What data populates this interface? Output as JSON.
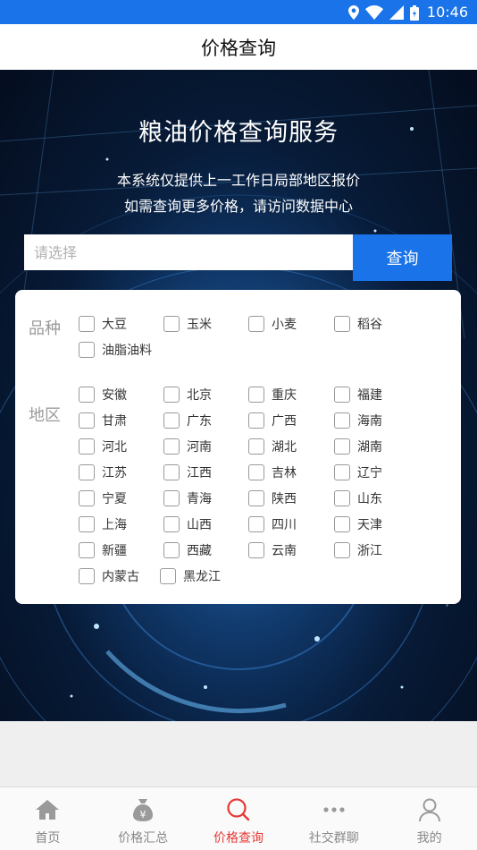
{
  "status_bar": {
    "time": "10:46",
    "bg_color": "#1a73e8"
  },
  "header": {
    "title": "价格查询"
  },
  "hero": {
    "title": "粮油价格查询服务",
    "subtitle_line1": "本系统仅提供上一工作日局部地区报价",
    "subtitle_line2": "如需查询更多价格，请访问数据中心"
  },
  "search": {
    "placeholder": "请选择",
    "value": "",
    "button_label": "查询",
    "accent_color": "#1a73e8"
  },
  "filters": {
    "variety": {
      "label": "品种",
      "options": [
        "大豆",
        "玉米",
        "小麦",
        "稻谷",
        "油脂油料"
      ]
    },
    "region": {
      "label": "地区",
      "options": [
        "安徽",
        "北京",
        "重庆",
        "福建",
        "甘肃",
        "广东",
        "广西",
        "海南",
        "河北",
        "河南",
        "湖北",
        "湖南",
        "江苏",
        "江西",
        "吉林",
        "辽宁",
        "宁夏",
        "青海",
        "陕西",
        "山东",
        "上海",
        "山西",
        "四川",
        "天津",
        "新疆",
        "西藏",
        "云南",
        "浙江",
        "内蒙古",
        "黑龙江"
      ]
    }
  },
  "tab_bar": {
    "active_color": "#e53935",
    "items": [
      {
        "label": "首页",
        "icon": "home-icon"
      },
      {
        "label": "价格汇总",
        "icon": "money-bag-icon"
      },
      {
        "label": "价格查询",
        "icon": "search-icon"
      },
      {
        "label": "社交群聊",
        "icon": "more-dots-icon"
      },
      {
        "label": "我的",
        "icon": "user-icon"
      }
    ]
  }
}
